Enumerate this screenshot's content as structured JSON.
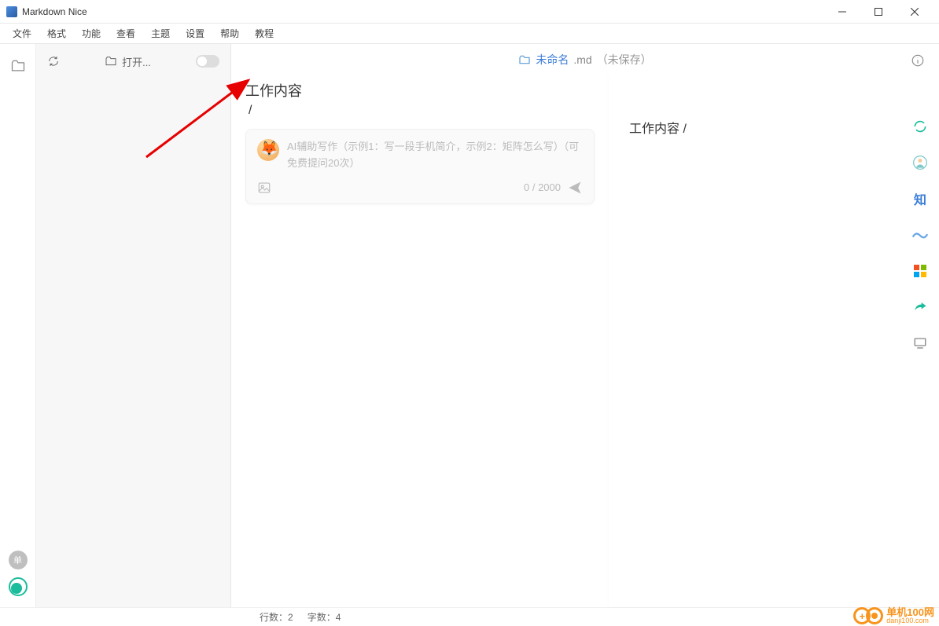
{
  "titlebar": {
    "title": "Markdown Nice"
  },
  "menu": {
    "items": [
      "文件",
      "格式",
      "功能",
      "查看",
      "主题",
      "设置",
      "帮助",
      "教程"
    ]
  },
  "sidebar": {
    "open_label": "打开..."
  },
  "file": {
    "name": "未命名",
    "ext": ".md",
    "status": "（未保存）"
  },
  "editor": {
    "heading": "工作内容",
    "cursor_line": "/",
    "ai_placeholder": "AI辅助写作（示例1：写一段手机简介，示例2：矩阵怎么写）（可免费提问20次）",
    "counter": "0 / 2000"
  },
  "preview": {
    "text": "工作内容 /"
  },
  "right_rail": {
    "zhi": "知"
  },
  "status": {
    "lines_label": "行数：",
    "lines": "2",
    "chars_label": "字数：",
    "chars": "4"
  },
  "badge": {
    "dan": "单"
  },
  "watermark": {
    "title": "单机100网",
    "url": "danji100.com"
  }
}
